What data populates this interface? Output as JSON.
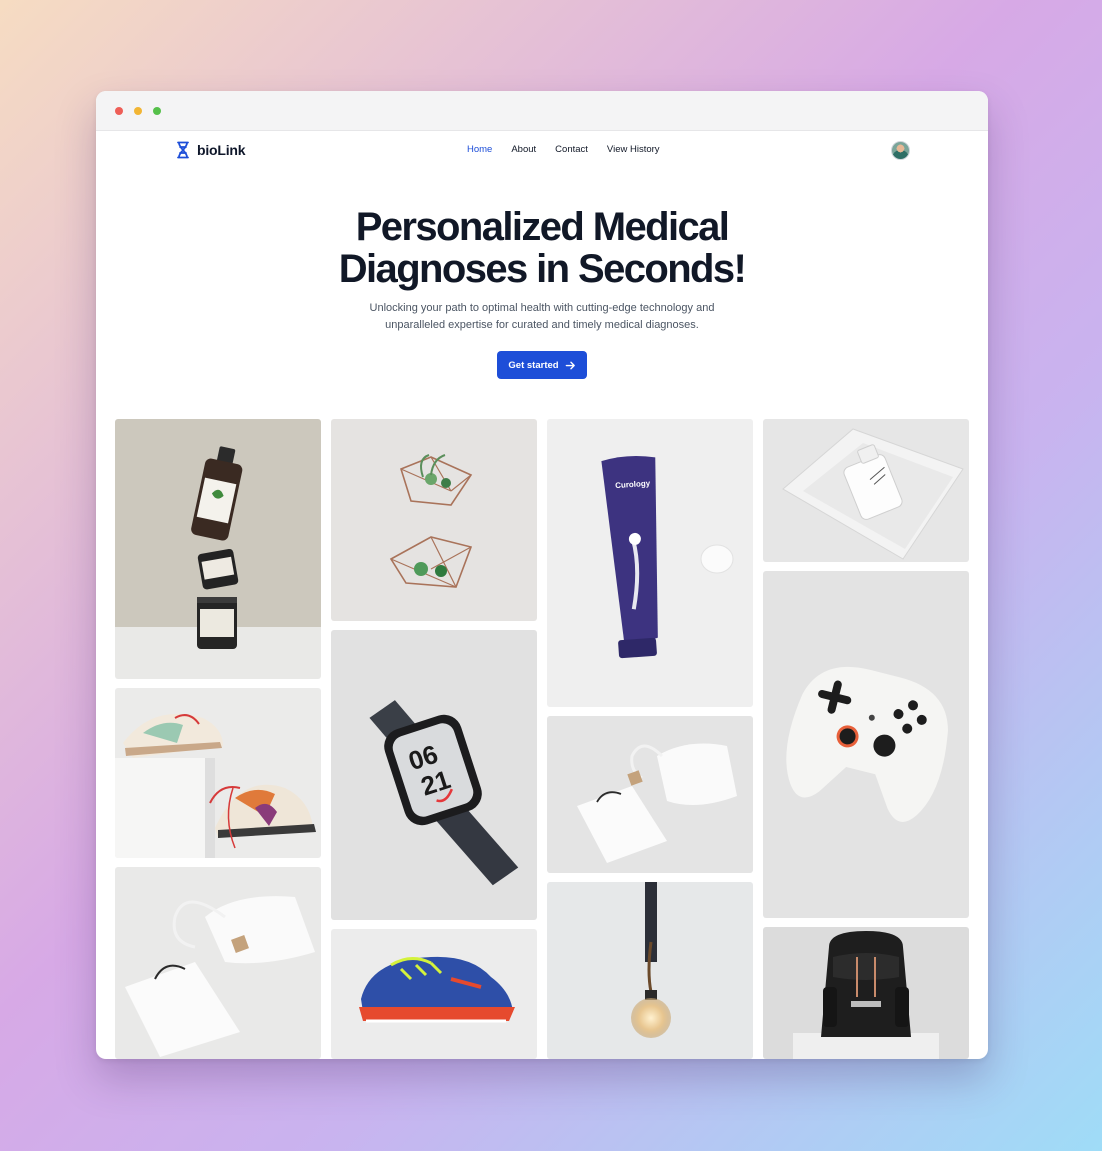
{
  "window": {
    "controls": [
      "close",
      "minimize",
      "maximize"
    ]
  },
  "brand": {
    "name": "bioLink",
    "icon": "dna-icon",
    "color": "#1d4ed8"
  },
  "nav": {
    "items": [
      {
        "label": "Home",
        "active": true
      },
      {
        "label": "About",
        "active": false
      },
      {
        "label": "Contact",
        "active": false
      },
      {
        "label": "View History",
        "active": false
      }
    ]
  },
  "user": {
    "avatar": "user-avatar"
  },
  "hero": {
    "title_line1": "Personalized Medical",
    "title_line2": "Diagnoses in Seconds!",
    "subtitle": "Unlocking your path to optimal health with cutting-edge technology and unparalleled expertise for curated and timely medical diagnoses.",
    "cta_label": "Get started",
    "cta_icon": "arrow-right-icon"
  },
  "gallery": {
    "images": [
      {
        "name": "supplement-jars-image",
        "product_text": "HEMP SEED"
      },
      {
        "name": "sneakers-image"
      },
      {
        "name": "tote-bag-image"
      },
      {
        "name": "terrarium-image"
      },
      {
        "name": "smartwatch-image",
        "product_text": "06 21"
      },
      {
        "name": "soccer-shoe-image"
      },
      {
        "name": "skincare-tube-image",
        "product_text": "Curology"
      },
      {
        "name": "pouch-bag-image"
      },
      {
        "name": "pendant-lamp-image"
      },
      {
        "name": "serum-bottle-image"
      },
      {
        "name": "game-controller-image"
      },
      {
        "name": "backpack-image"
      }
    ]
  }
}
